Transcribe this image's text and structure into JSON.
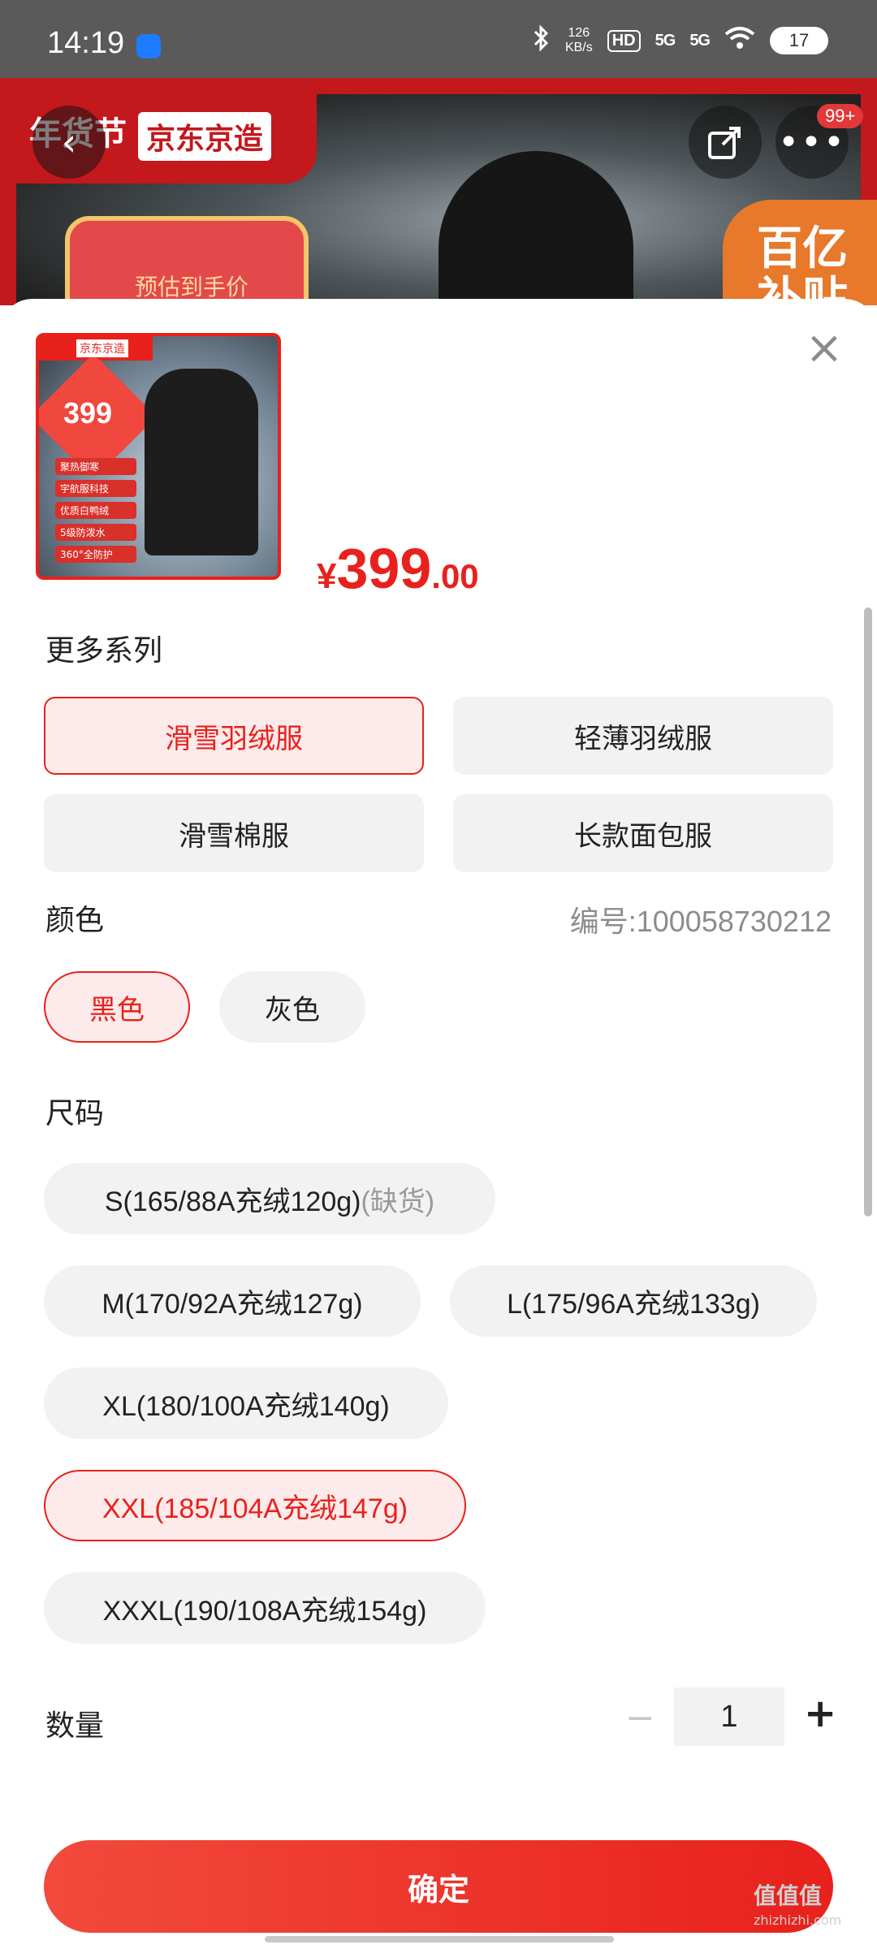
{
  "status_bar": {
    "time": "14:19",
    "net_speed_value": "126",
    "net_speed_unit": "KB/s",
    "hd_label": "HD",
    "signal_1": "5G",
    "signal_2": "5G",
    "battery": "17"
  },
  "banner": {
    "festival_label": "年货节",
    "brand_label": "京东京造",
    "left_badge_text": "预估到手价",
    "right_badge_text": "百亿补贴",
    "notification_count": "99+"
  },
  "product": {
    "thumb_brand": "京东京造",
    "thumb_price": "399",
    "thumb_chips": [
      "聚热御寒",
      "宇航服科技",
      "优质白鸭绒",
      "5级防泼水",
      "360°全防护"
    ],
    "price_currency": "¥",
    "price_main": "399",
    "price_decimal": ".00"
  },
  "series": {
    "title": "更多系列",
    "options": [
      "滑雪羽绒服",
      "轻薄羽绒服",
      "滑雪棉服",
      "长款面包服"
    ],
    "selected_index": 0
  },
  "color": {
    "title": "颜色",
    "serial_label": "编号:100058730212",
    "options": [
      "黑色",
      "灰色"
    ],
    "selected_index": 0
  },
  "size": {
    "title": "尺码",
    "options": [
      {
        "label": "S(165/88A充绒120g)",
        "suffix": "(缺货)"
      },
      {
        "label": "M(170/92A充绒127g)",
        "suffix": ""
      },
      {
        "label": "L(175/96A充绒133g)",
        "suffix": ""
      },
      {
        "label": "XL(180/100A充绒140g)",
        "suffix": ""
      },
      {
        "label": "XXL(185/104A充绒147g)",
        "suffix": ""
      },
      {
        "label": "XXXL(190/108A充绒154g)",
        "suffix": ""
      }
    ],
    "selected_index": 4
  },
  "quantity": {
    "title": "数量",
    "value": "1",
    "minus": "−",
    "plus": "+"
  },
  "confirm_label": "确定",
  "watermark": {
    "main": "值值值",
    "sub": "zhizhizhi.com"
  },
  "colors": {
    "accent": "#e8211c",
    "chip_bg": "#f2f2f2",
    "selected_bg": "#fdeaea"
  }
}
